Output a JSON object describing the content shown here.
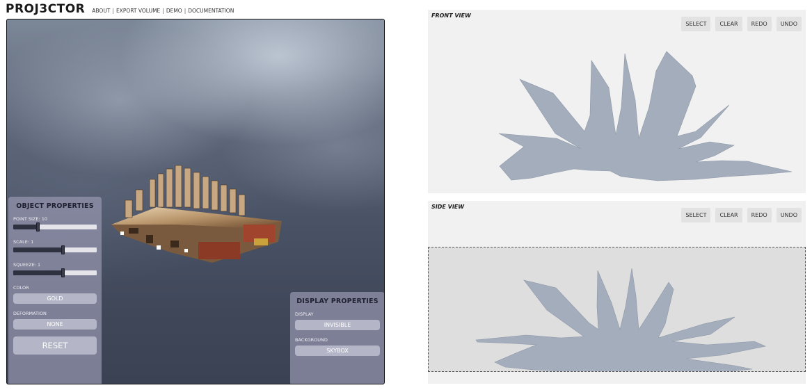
{
  "header": {
    "title": "PROJ3CTOR",
    "nav": [
      "ABOUT",
      "EXPORT VOLUME",
      "DEMO",
      "DOCUMENTATION"
    ]
  },
  "object_properties": {
    "heading": "OBJECT PROPERTIES",
    "point_size_label": "POINT SIZE: 10",
    "point_size_value": 0.3,
    "scale_label": "SCALE: 1",
    "scale_value": 0.6,
    "squeeze_label": "SQUEEZE: 1",
    "squeeze_value": 0.6,
    "color_label": "COLOR",
    "color_value": "GOLD",
    "deformation_label": "DEFORMATION",
    "deformation_value": "NONE",
    "reset_label": "RESET"
  },
  "display_properties": {
    "heading": "DISPLAY PROPERTIES",
    "display_label": "DISPLAY",
    "display_value": "INVISIBLE",
    "background_label": "BACKGROUND",
    "background_value": "SKYBOX"
  },
  "front_view": {
    "title": "FRONT VIEW",
    "buttons": [
      "SELECT",
      "CLEAR",
      "REDO",
      "UNDO"
    ]
  },
  "side_view": {
    "title": "SIDE VIEW",
    "buttons": [
      "SELECT",
      "CLEAR",
      "REDO",
      "UNDO"
    ]
  },
  "colors": {
    "silhouette": "#a3adbc",
    "panel": "#9696af",
    "pill": "#b4b6c8"
  }
}
